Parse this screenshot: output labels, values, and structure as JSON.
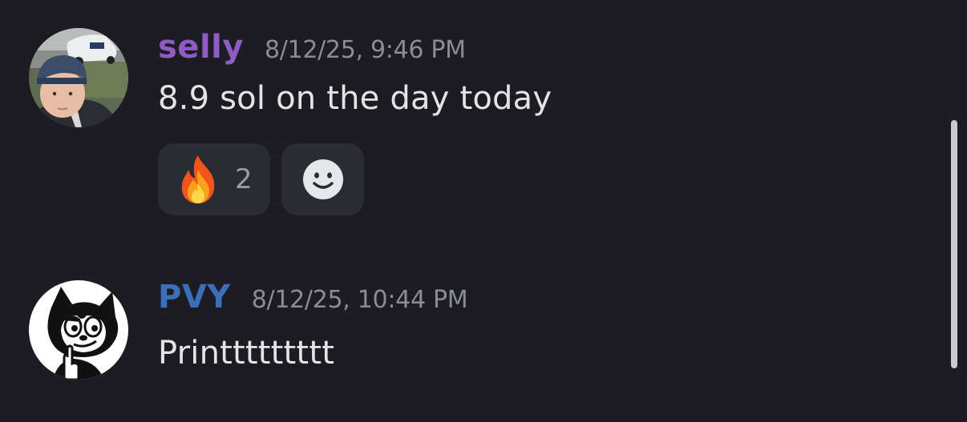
{
  "messages": [
    {
      "username": "selly",
      "username_color": "#8f5cc4",
      "timestamp": "8/12/25, 9:46 PM",
      "text": "8.9 sol on the day today",
      "avatar_icon": "user-avatar-photo",
      "reactions": [
        {
          "emoji": "fire-emoji",
          "count": "2"
        }
      ],
      "add_reaction_icon": "smiley-face-icon"
    },
    {
      "username": "PVY",
      "username_color": "#3b6fba",
      "timestamp": "8/12/25, 10:44 PM",
      "text": "Printtttttttt",
      "avatar_icon": "cartoon-cat-avatar"
    }
  ],
  "colors": {
    "background": "#1c1c22",
    "reaction_background": "#2b2c33",
    "timestamp": "#8a8d96",
    "message_text": "#e3e4e8"
  }
}
